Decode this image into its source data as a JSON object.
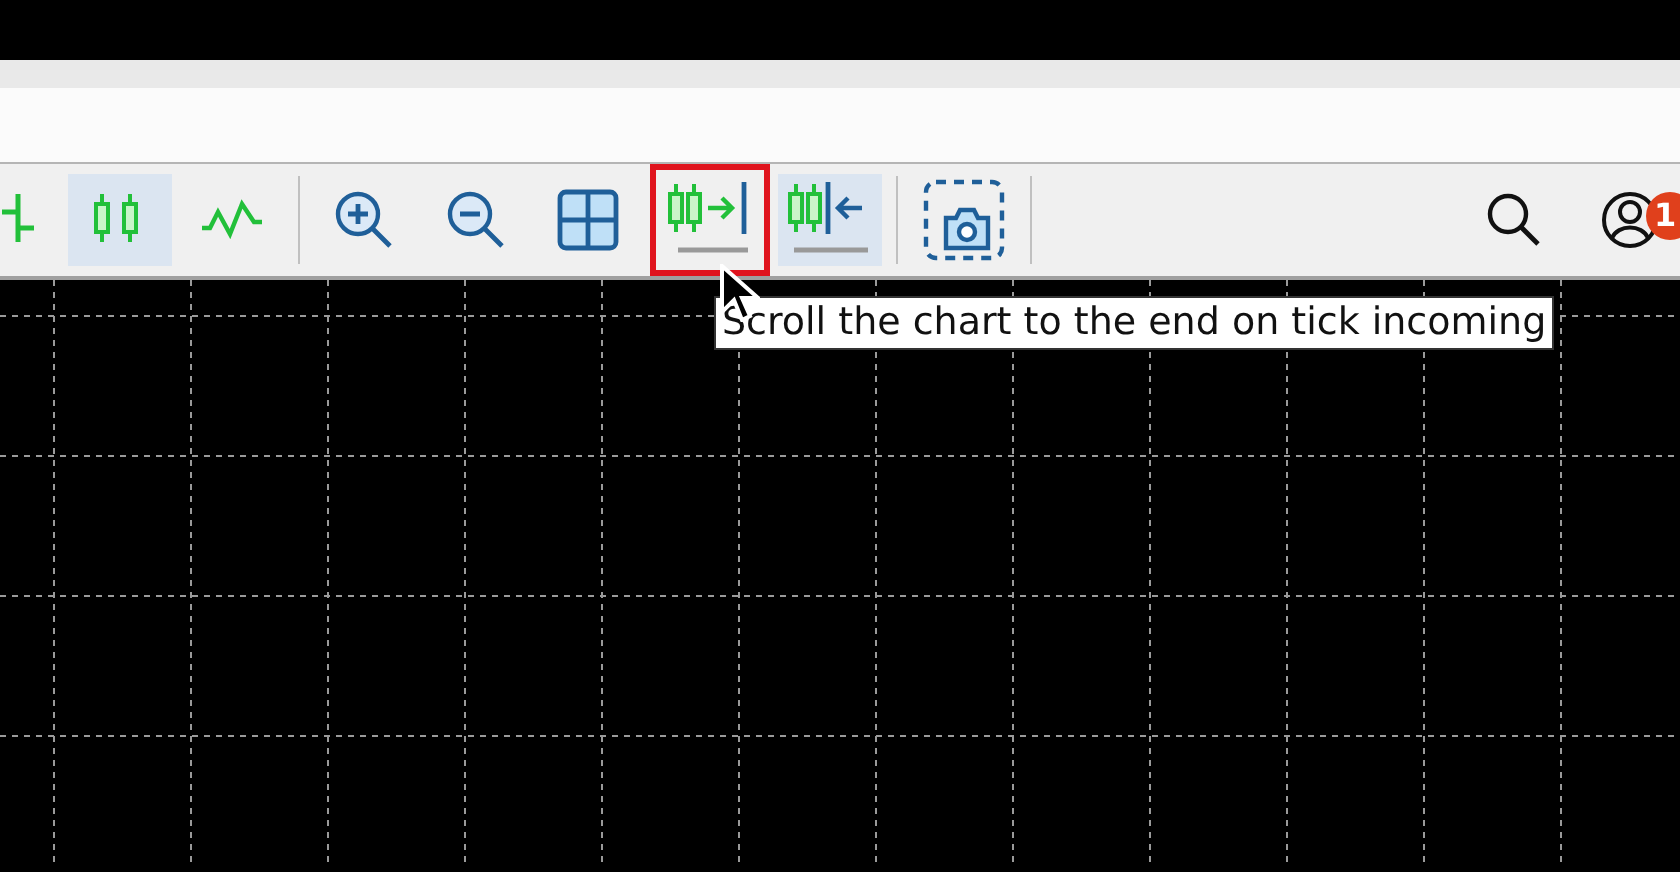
{
  "toolbar": {
    "buttons": [
      {
        "kind": "bars",
        "selected": false,
        "highlighted": false
      },
      {
        "kind": "candles",
        "selected": true,
        "highlighted": false
      },
      {
        "kind": "line",
        "selected": false,
        "highlighted": false
      },
      {
        "kind": "separator"
      },
      {
        "kind": "zoom-in",
        "selected": false,
        "highlighted": false
      },
      {
        "kind": "zoom-out",
        "selected": false,
        "highlighted": false
      },
      {
        "kind": "tile",
        "selected": false,
        "highlighted": false
      },
      {
        "kind": "autoscroll",
        "selected": false,
        "highlighted": true
      },
      {
        "kind": "shift",
        "selected": true,
        "highlighted": false
      },
      {
        "kind": "separator"
      },
      {
        "kind": "screenshot",
        "selected": false,
        "highlighted": false
      },
      {
        "kind": "separator"
      }
    ],
    "account_badge": "1"
  },
  "tooltip": "Scroll the chart to the end on tick incoming"
}
